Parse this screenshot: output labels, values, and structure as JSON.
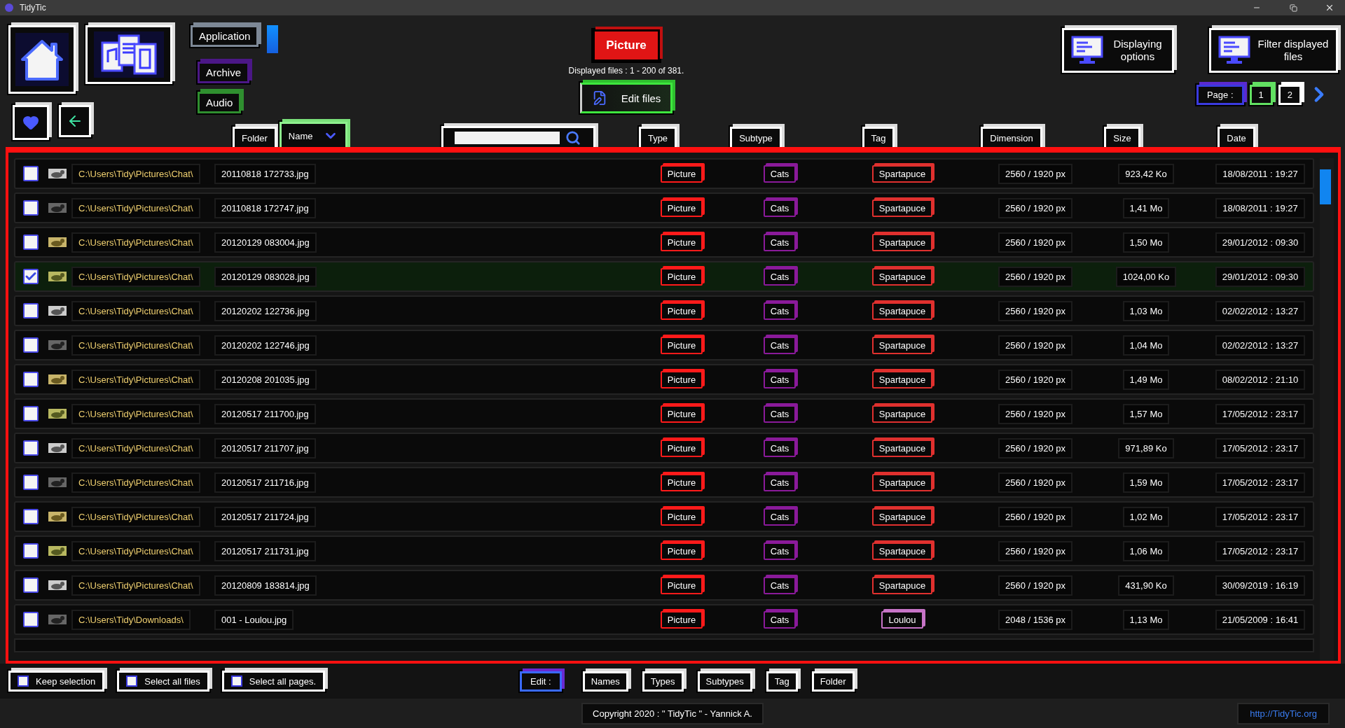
{
  "window": {
    "title": "TidyTic"
  },
  "categories": [
    {
      "label": "Application",
      "color": "#7d8896"
    },
    {
      "label": "Archive",
      "color": "#4b1786"
    },
    {
      "label": "Audio",
      "color": "#2f8f2f"
    }
  ],
  "current_category": {
    "label": "Picture"
  },
  "displayed_files": "Displayed files : 1 - 200 of 381.",
  "edit_files_button": "Edit files",
  "displaying_options_button": "Displaying options",
  "filter_button": "Filter displayed files",
  "pagination": {
    "label": "Page :",
    "pages": [
      {
        "label": "1",
        "selected": true
      },
      {
        "label": "2",
        "selected": false
      }
    ]
  },
  "columns": [
    {
      "label": "Folder",
      "selected": false
    },
    {
      "label": "Name",
      "selected": true
    },
    {
      "label": "Type",
      "selected": false
    },
    {
      "label": "Subtype",
      "selected": false
    },
    {
      "label": "Tag",
      "selected": false
    },
    {
      "label": "Dimension",
      "selected": false
    },
    {
      "label": "Size",
      "selected": false
    },
    {
      "label": "Date",
      "selected": false
    }
  ],
  "rows": [
    {
      "checked": false,
      "folder": "C:\\Users\\Tidy\\Pictures\\Chat\\",
      "name": "20110818 172733.jpg",
      "type": "Picture",
      "subtype": "Cats",
      "tag": {
        "label": "Spartapuce",
        "color": "#e0302e"
      },
      "dimension": "2560 / 1920 px",
      "size": "923,42 Ko",
      "date": "18/08/2011 : 19:27"
    },
    {
      "checked": false,
      "folder": "C:\\Users\\Tidy\\Pictures\\Chat\\",
      "name": "20110818 172747.jpg",
      "type": "Picture",
      "subtype": "Cats",
      "tag": {
        "label": "Spartapuce",
        "color": "#e0302e"
      },
      "dimension": "2560 / 1920 px",
      "size": "1,41 Mo",
      "date": "18/08/2011 : 19:27"
    },
    {
      "checked": false,
      "folder": "C:\\Users\\Tidy\\Pictures\\Chat\\",
      "name": "20120129 083004.jpg",
      "type": "Picture",
      "subtype": "Cats",
      "tag": {
        "label": "Spartapuce",
        "color": "#e0302e"
      },
      "dimension": "2560 / 1920 px",
      "size": "1,50 Mo",
      "date": "29/01/2012 : 09:30"
    },
    {
      "checked": true,
      "folder": "C:\\Users\\Tidy\\Pictures\\Chat\\",
      "name": "20120129 083028.jpg",
      "type": "Picture",
      "subtype": "Cats",
      "tag": {
        "label": "Spartapuce",
        "color": "#e0302e"
      },
      "dimension": "2560 / 1920 px",
      "size": "1024,00 Ko",
      "date": "29/01/2012 : 09:30"
    },
    {
      "checked": false,
      "folder": "C:\\Users\\Tidy\\Pictures\\Chat\\",
      "name": "20120202 122736.jpg",
      "type": "Picture",
      "subtype": "Cats",
      "tag": {
        "label": "Spartapuce",
        "color": "#e0302e"
      },
      "dimension": "2560 / 1920 px",
      "size": "1,03 Mo",
      "date": "02/02/2012 : 13:27"
    },
    {
      "checked": false,
      "folder": "C:\\Users\\Tidy\\Pictures\\Chat\\",
      "name": "20120202 122746.jpg",
      "type": "Picture",
      "subtype": "Cats",
      "tag": {
        "label": "Spartapuce",
        "color": "#e0302e"
      },
      "dimension": "2560 / 1920 px",
      "size": "1,04 Mo",
      "date": "02/02/2012 : 13:27"
    },
    {
      "checked": false,
      "folder": "C:\\Users\\Tidy\\Pictures\\Chat\\",
      "name": "20120208 201035.jpg",
      "type": "Picture",
      "subtype": "Cats",
      "tag": {
        "label": "Spartapuce",
        "color": "#e0302e"
      },
      "dimension": "2560 / 1920 px",
      "size": "1,49 Mo",
      "date": "08/02/2012 : 21:10"
    },
    {
      "checked": false,
      "folder": "C:\\Users\\Tidy\\Pictures\\Chat\\",
      "name": "20120517 211700.jpg",
      "type": "Picture",
      "subtype": "Cats",
      "tag": {
        "label": "Spartapuce",
        "color": "#e0302e"
      },
      "dimension": "2560 / 1920 px",
      "size": "1,57 Mo",
      "date": "17/05/2012 : 23:17"
    },
    {
      "checked": false,
      "folder": "C:\\Users\\Tidy\\Pictures\\Chat\\",
      "name": "20120517 211707.jpg",
      "type": "Picture",
      "subtype": "Cats",
      "tag": {
        "label": "Spartapuce",
        "color": "#e0302e"
      },
      "dimension": "2560 / 1920 px",
      "size": "971,89 Ko",
      "date": "17/05/2012 : 23:17"
    },
    {
      "checked": false,
      "folder": "C:\\Users\\Tidy\\Pictures\\Chat\\",
      "name": "20120517 211716.jpg",
      "type": "Picture",
      "subtype": "Cats",
      "tag": {
        "label": "Spartapuce",
        "color": "#e0302e"
      },
      "dimension": "2560 / 1920 px",
      "size": "1,59 Mo",
      "date": "17/05/2012 : 23:17"
    },
    {
      "checked": false,
      "folder": "C:\\Users\\Tidy\\Pictures\\Chat\\",
      "name": "20120517 211724.jpg",
      "type": "Picture",
      "subtype": "Cats",
      "tag": {
        "label": "Spartapuce",
        "color": "#e0302e"
      },
      "dimension": "2560 / 1920 px",
      "size": "1,02 Mo",
      "date": "17/05/2012 : 23:17"
    },
    {
      "checked": false,
      "folder": "C:\\Users\\Tidy\\Pictures\\Chat\\",
      "name": "20120517 211731.jpg",
      "type": "Picture",
      "subtype": "Cats",
      "tag": {
        "label": "Spartapuce",
        "color": "#e0302e"
      },
      "dimension": "2560 / 1920 px",
      "size": "1,06 Mo",
      "date": "17/05/2012 : 23:17"
    },
    {
      "checked": false,
      "folder": "C:\\Users\\Tidy\\Pictures\\Chat\\",
      "name": "20120809 183814.jpg",
      "type": "Picture",
      "subtype": "Cats",
      "tag": {
        "label": "Spartapuce",
        "color": "#e0302e"
      },
      "dimension": "2560 / 1920 px",
      "size": "431,90 Ko",
      "date": "30/09/2019 : 16:19"
    },
    {
      "checked": false,
      "folder": "C:\\Users\\Tidy\\Downloads\\",
      "name": "001 - Loulou.jpg",
      "type": "Picture",
      "subtype": "Cats",
      "tag": {
        "label": "Loulou",
        "color": "#c774c7"
      },
      "dimension": "2048 / 1536 px",
      "size": "1,13 Mo",
      "date": "21/05/2009 : 16:41"
    }
  ],
  "selection_buttons": [
    "Keep selection",
    "Select all files",
    "Select all pages."
  ],
  "edit_bar": {
    "label": "Edit :",
    "buttons": [
      "Names",
      "Types",
      "Subtypes",
      "Tag",
      "Folder"
    ]
  },
  "footer": {
    "copyright": "Copyright 2020 : \" TidyTic \" - Yannick A.",
    "link": "http://TidyTic.org"
  }
}
